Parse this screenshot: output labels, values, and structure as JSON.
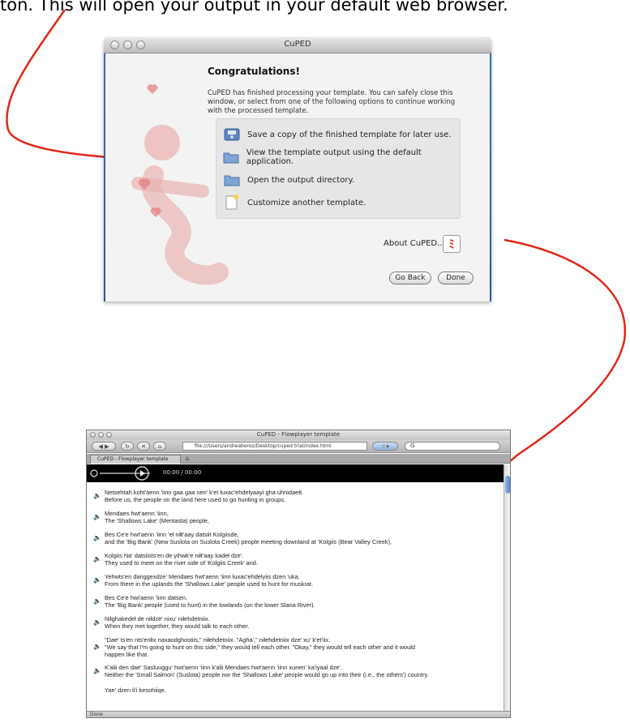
{
  "caption": "ton. This will open your output in your default web browser.",
  "colors": {
    "arrow": "#e0281a",
    "mac_blue": "#3a6ebd"
  },
  "dialog": {
    "window_title": "CuPED",
    "heading": "Congratulations!",
    "intro": "CuPED has finished processing your template. You can safely close this window, or select from one of the following options to continue working with the processed template.",
    "options": [
      {
        "icon": "save-disk-icon",
        "label": "Save a copy of the finished template for later use."
      },
      {
        "icon": "folder-icon",
        "label": "View the template output using the default application."
      },
      {
        "icon": "folder-icon",
        "label": "Open the output directory."
      },
      {
        "icon": "new-document-icon",
        "label": "Customize another template."
      }
    ],
    "about_label": "About CuPED...",
    "go_back": "Go Back",
    "done": "Done"
  },
  "browser": {
    "window_title": "CuPED - Flowplayer template",
    "url": "file:///Users/andreaberez/Desktop/cuped trial/index.html",
    "search_value": "G",
    "tab_label": "CuPED - Flowplayer template",
    "player_time": "00:00 / 00:00",
    "status": "Done",
    "entries": [
      {
        "native": "Netsehtah koht'aenn 'iinn gaa gaa nen' k'et łuxac'ehdelyaayi gha uhnidaetł.",
        "english": [
          "Before us, the people on the land here used to go hunting in groups."
        ]
      },
      {
        "native": "Mendaes hwt'aenn 'iinn,",
        "english": [
          "The 'Shallows Lake' (Mentasta) people,"
        ]
      },
      {
        "native": "Bes Ce'e hwt'aenn 'iinn 'eł niłt'aay datsiit Kolgiisde,",
        "english": [
          "and the 'Big Bank' (New Suslota on Suslota Creek) people meeting downland at 'Kolgiis (Bear Valley Creek),"
        ]
      },
      {
        "native": "Kolgiis Na' datsiists'en de yihwk'e niłt'aay kadeł dze'.",
        "english": [
          "They used to meet on the river side of 'Kolgiis Creek' and."
        ]
      },
      {
        "native": "Yehwts'en danggexdze' Mendaes hwt'aenn 'iinn łuxac'ehdelyiis dzen 'uka.",
        "english": [
          "From there in the uplands the 'Shallows Lake' people used to hunt for muskrat."
        ]
      },
      {
        "native": "Bes Ce'e hwi'aenn 'iinn datsen.",
        "english": [
          "The 'Big Bank' people (used to hunt) in the lowlands (on the lower Slana River)."
        ]
      },
      {
        "native": "Niłghakedeł de niłdze' nixu' niłehdetniix.",
        "english": [
          "When they met together, they would talk to each other."
        ]
      },
      {
        "native": "\"Dae' ts'en nts'enłix naxaodghostiis,\" niłehdetniix. \"Agha',\" niłehdetniix dze' xu' k'et'iix.",
        "english": [
          "\"We say that I'm going to hunt on this side,\" they would tell each other. \"Okay,\" they would tell each other and it would",
          "happen like that."
        ]
      },
      {
        "native": "K'alii den dae' Sasluuggu' hwt'aenn 'iinn k'alii Mendaes hwt'aenn 'iinn xunen' ka'iyaal dze'.",
        "english": [
          "Neither the 'Small Salmon' (Suslota) people nor the 'Shallows Lake' people would go up into their (i.e., the others') country."
        ]
      },
      {
        "native": "Yae' dzen li'i kesohiiqe.",
        "english": []
      }
    ]
  }
}
